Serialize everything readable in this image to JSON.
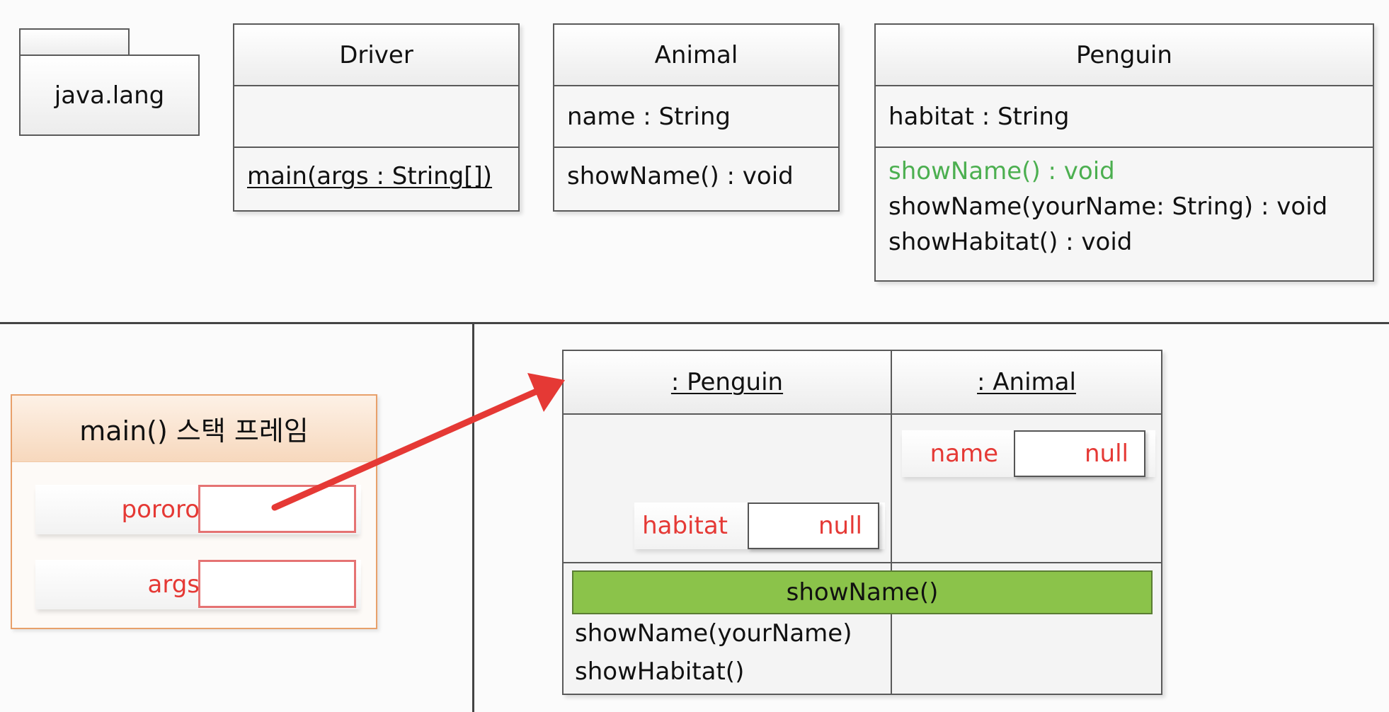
{
  "package": {
    "label": "java.lang"
  },
  "classes": {
    "driver": {
      "name": "Driver",
      "method": "main(args : String[])"
    },
    "animal": {
      "name": "Animal",
      "attribute": "name : String",
      "method": "showName() : void"
    },
    "penguin": {
      "name": "Penguin",
      "attribute": "habitat : String",
      "methods": [
        "showName() : void",
        "showName(yourName: String) : void",
        "showHabitat() : void"
      ]
    }
  },
  "stack_frame": {
    "title": "main() 스택 프레임",
    "vars": [
      "pororo",
      "args"
    ]
  },
  "heap": {
    "penguin_title": ": Penguin",
    "animal_title": ": Animal",
    "animal_field": {
      "name": "name",
      "value": "null"
    },
    "penguin_field": {
      "name": "habitat",
      "value": "null"
    },
    "shared_method": "showName()",
    "penguin_methods": [
      "showName(yourName)",
      "showHabitat()"
    ]
  },
  "colors": {
    "overridden_method": "#4caf50",
    "variable_label": "#e53935",
    "stack_frame_border": "#e8a06a",
    "arrow": "#e53935",
    "method_bar": "#8bc34a"
  }
}
